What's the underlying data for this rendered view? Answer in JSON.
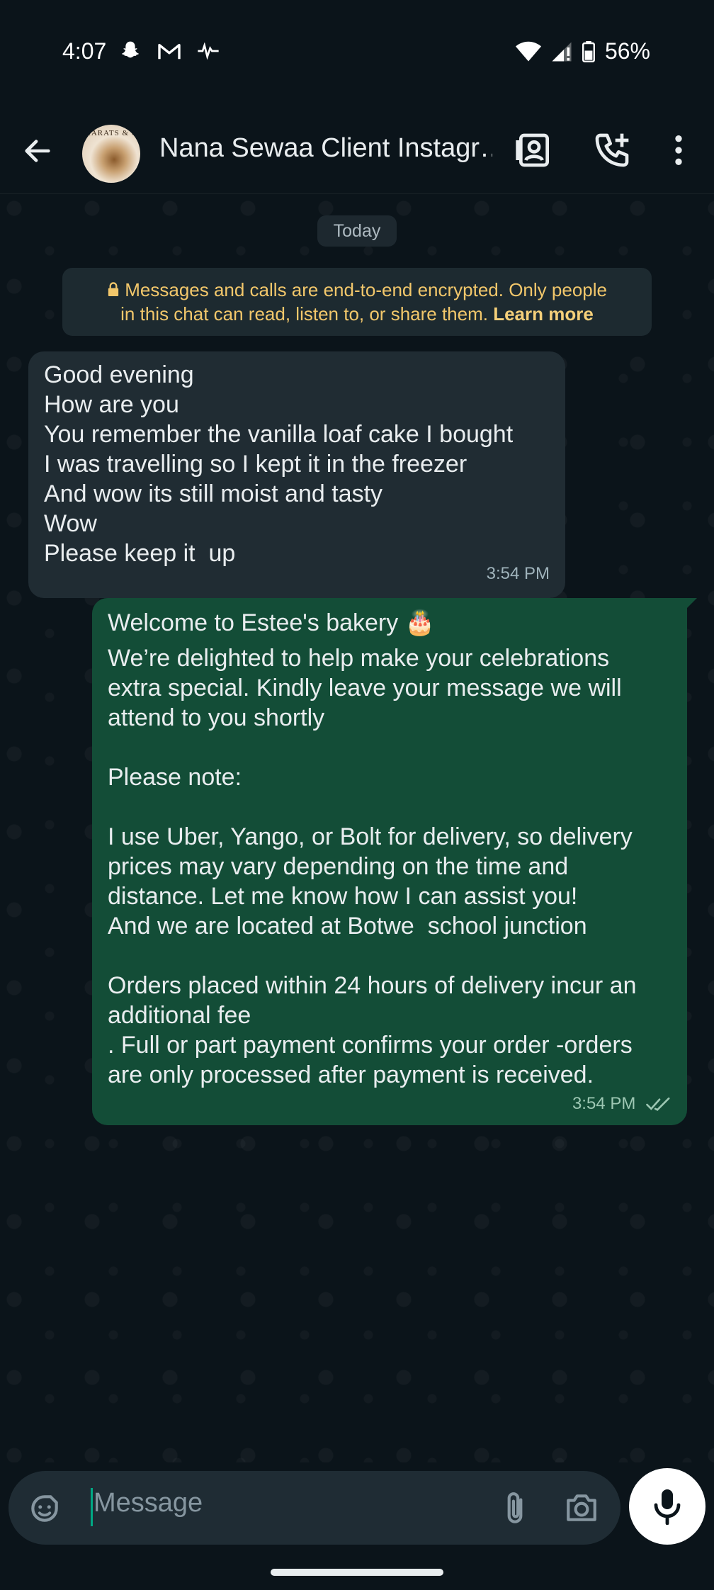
{
  "status_bar": {
    "time": "4:07",
    "battery": "56%",
    "icons": [
      "snapchat-icon",
      "gmail-icon",
      "activity-icon",
      "wifi-icon",
      "signal-icon",
      "battery-icon"
    ]
  },
  "header": {
    "back_icon": "arrow-left-icon",
    "avatar_text": "KARATS & C",
    "title": "Nana Sewaa Client Instagr…",
    "actions": [
      "contact-card-icon",
      "add-call-icon",
      "more-vert-icon"
    ]
  },
  "chat": {
    "date_chip": "Today",
    "encryption": {
      "line1": "Messages and calls are end-to-end encrypted. Only people",
      "line2": "in this chat can read, listen to, or share them.",
      "learn_more": "Learn more"
    },
    "messages": [
      {
        "direction": "incoming",
        "lines": [
          "Good evening",
          "How are you",
          "You remember the vanilla loaf cake I bought",
          "I was travelling so I kept it in the freezer",
          "And wow its still moist and tasty",
          "Wow",
          "Please keep it  up"
        ],
        "time": "3:54 PM"
      },
      {
        "direction": "outgoing",
        "lines": [
          "Welcome to Estee's bakery 🎂",
          "We’re delighted to help make your celebrations",
          "extra special. Kindly leave your message we will",
          "attend to you shortly",
          "",
          "Please note:",
          "",
          "I use Uber, Yango, or Bolt for delivery, so delivery",
          "prices may vary depending on the time and",
          "distance. Let me know how I can assist you!",
          "And we are located at Botwe  school junction",
          "",
          "Orders placed within 24 hours of delivery incur an",
          "additional fee",
          ". Full or part payment confirms your order -orders",
          "are only processed after payment is received."
        ],
        "time": "3:54 PM",
        "status": "read"
      }
    ]
  },
  "composer": {
    "placeholder": "Message",
    "icons": [
      "sticker-icon",
      "paperclip-icon",
      "camera-icon",
      "microphone-icon"
    ]
  },
  "colors": {
    "background": "#0b141a",
    "incoming_bubble": "#202c33",
    "outgoing_bubble": "#134d37",
    "encryption_text": "#f2c76b",
    "accent": "#00a884"
  }
}
